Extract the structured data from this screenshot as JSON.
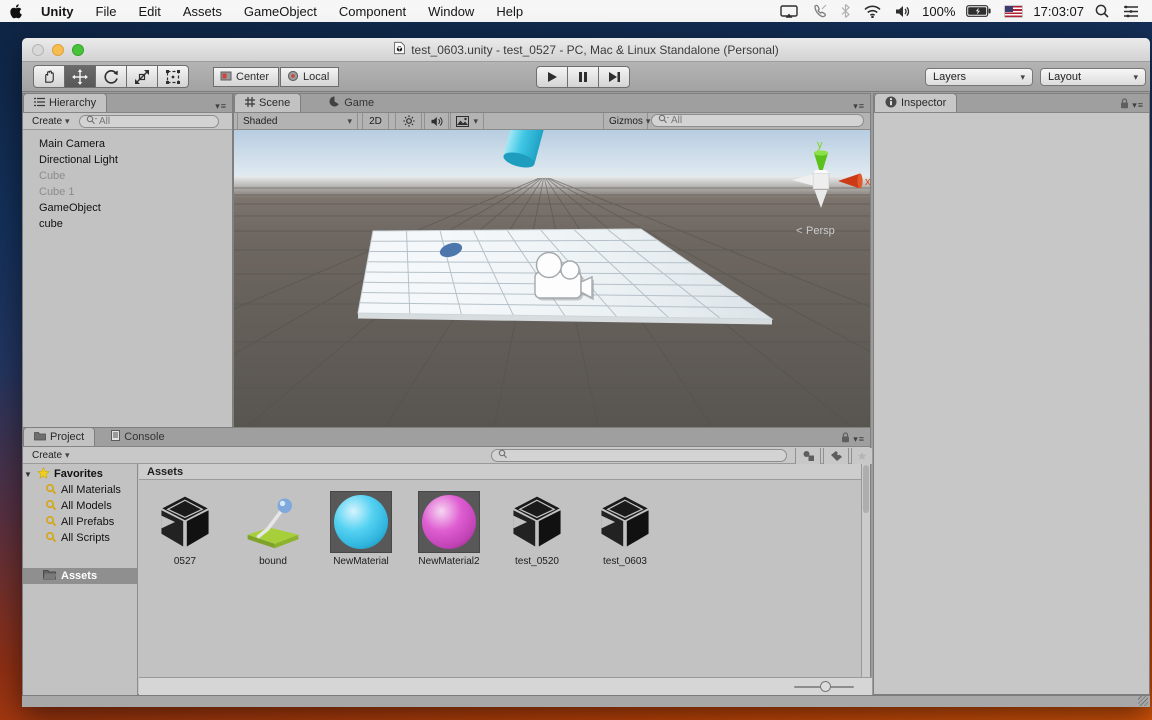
{
  "menu_bar": {
    "items": [
      "Unity",
      "File",
      "Edit",
      "Assets",
      "GameObject",
      "Component",
      "Window",
      "Help"
    ],
    "battery_percent": "100%",
    "clock": "17:03:07"
  },
  "window_title": "test_0603.unity - test_0527 - PC, Mac & Linux Standalone (Personal)",
  "toolbar": {
    "tools": [
      "hand",
      "move",
      "rotate",
      "scale",
      "rect"
    ],
    "active_tool": "move",
    "center_label": "Center",
    "local_label": "Local",
    "layers_label": "Layers",
    "layout_label": "Layout"
  },
  "hierarchy": {
    "tab_label": "Hierarchy",
    "create_label": "Create",
    "search_placeholder": "All",
    "items": [
      {
        "name": "Main Camera",
        "enabled": true
      },
      {
        "name": "Directional Light",
        "enabled": true
      },
      {
        "name": "Cube",
        "enabled": false
      },
      {
        "name": "Cube 1",
        "enabled": false
      },
      {
        "name": "GameObject",
        "enabled": true
      },
      {
        "name": "cube",
        "enabled": true
      }
    ]
  },
  "scene_view": {
    "scene_tab_label": "Scene",
    "game_tab_label": "Game",
    "shading_mode": "Shaded",
    "toggle_2d_label": "2D",
    "gizmos_label": "Gizmos",
    "search_placeholder": "All",
    "projection_label": "Persp",
    "axis_x_label": "x",
    "axis_y_label": "y",
    "colors": {
      "cylinder": "#3fc6e4",
      "sphere": "#4d76ac",
      "axis_x": "#d9431c",
      "axis_y": "#6fd321"
    }
  },
  "project": {
    "tab_label": "Project",
    "console_tab_label": "Console",
    "create_label": "Create",
    "favorites_label": "Favorites",
    "favorites": [
      "All Materials",
      "All Models",
      "All Prefabs",
      "All Scripts"
    ],
    "folder_label": "Assets",
    "breadcrumb_label": "Assets",
    "assets": [
      {
        "name": "0527",
        "type": "unity-file"
      },
      {
        "name": "bound",
        "type": "asset"
      },
      {
        "name": "NewMaterial",
        "type": "material",
        "color": "#3cc3ec"
      },
      {
        "name": "NewMaterial2",
        "type": "material",
        "color": "#cc4ec4"
      },
      {
        "name": "test_0520",
        "type": "unity-file"
      },
      {
        "name": "test_0603",
        "type": "unity-file"
      }
    ]
  },
  "inspector": {
    "tab_label": "Inspector"
  }
}
